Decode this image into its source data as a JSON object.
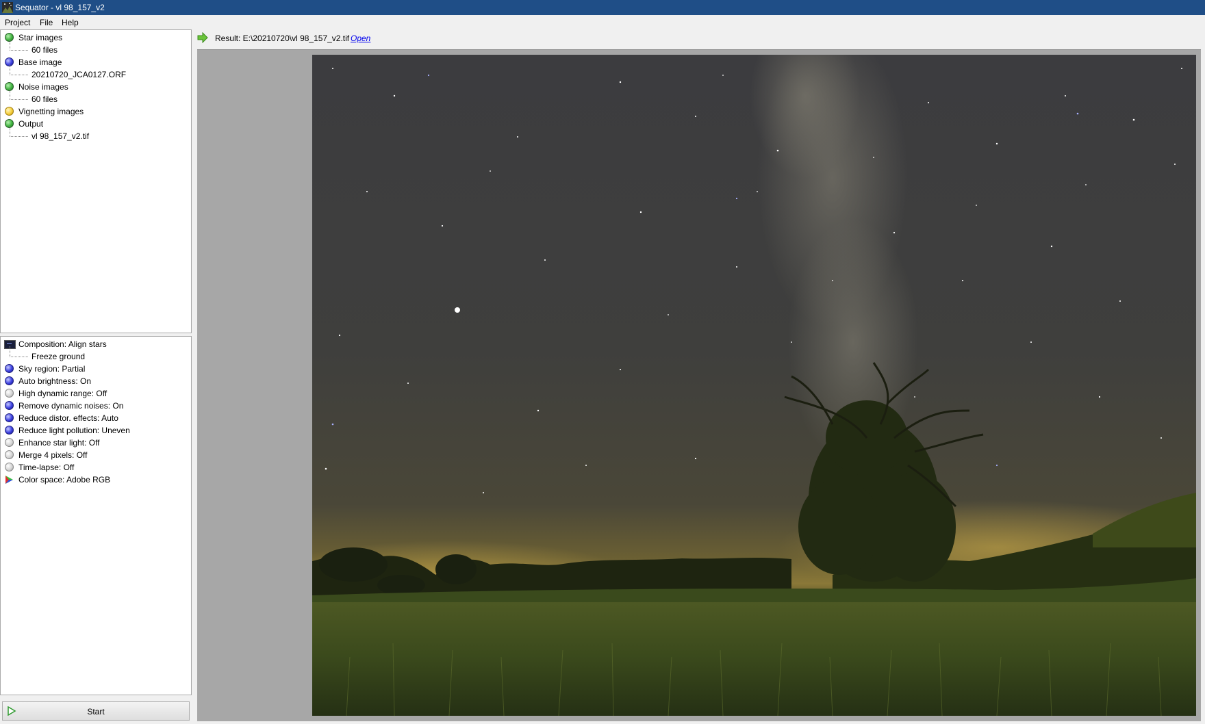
{
  "window": {
    "title": "Sequator - vl 98_157_v2"
  },
  "menu": [
    "Project",
    "File",
    "Help"
  ],
  "inputs_panel": {
    "items": [
      {
        "label": "Star images",
        "status": "green",
        "child": "60 files"
      },
      {
        "label": "Base image",
        "status": "blue",
        "child": "20210720_JCA0127.ORF"
      },
      {
        "label": "Noise images",
        "status": "green",
        "child": "60 files"
      },
      {
        "label": "Vignetting images",
        "status": "yellow"
      },
      {
        "label": "Output",
        "status": "green",
        "child": "vl 98_157_v2.tif"
      }
    ]
  },
  "settings_panel": {
    "composition": {
      "label": "Composition: Align stars",
      "child": "Freeze ground"
    },
    "items": [
      {
        "label": "Sky region: Partial",
        "status": "blue"
      },
      {
        "label": "Auto brightness: On",
        "status": "blue"
      },
      {
        "label": "High dynamic range: Off",
        "status": "gray"
      },
      {
        "label": "Remove dynamic noises: On",
        "status": "blue"
      },
      {
        "label": "Reduce distor. effects: Auto",
        "status": "blue"
      },
      {
        "label": "Reduce light pollution: Uneven",
        "status": "blue"
      },
      {
        "label": "Enhance star light: Off",
        "status": "gray"
      },
      {
        "label": "Merge 4 pixels: Off",
        "status": "gray"
      },
      {
        "label": "Time-lapse: Off",
        "status": "gray"
      }
    ],
    "color_space": "Color space: Adobe RGB"
  },
  "start_button": "Start",
  "result": {
    "text": "Result: E:\\20210720\\vl 98_157_v2.tif",
    "open_label": "Open"
  },
  "colors": {
    "titlebar": "#1f4e87",
    "viewer_bg": "#a7a7a7"
  }
}
